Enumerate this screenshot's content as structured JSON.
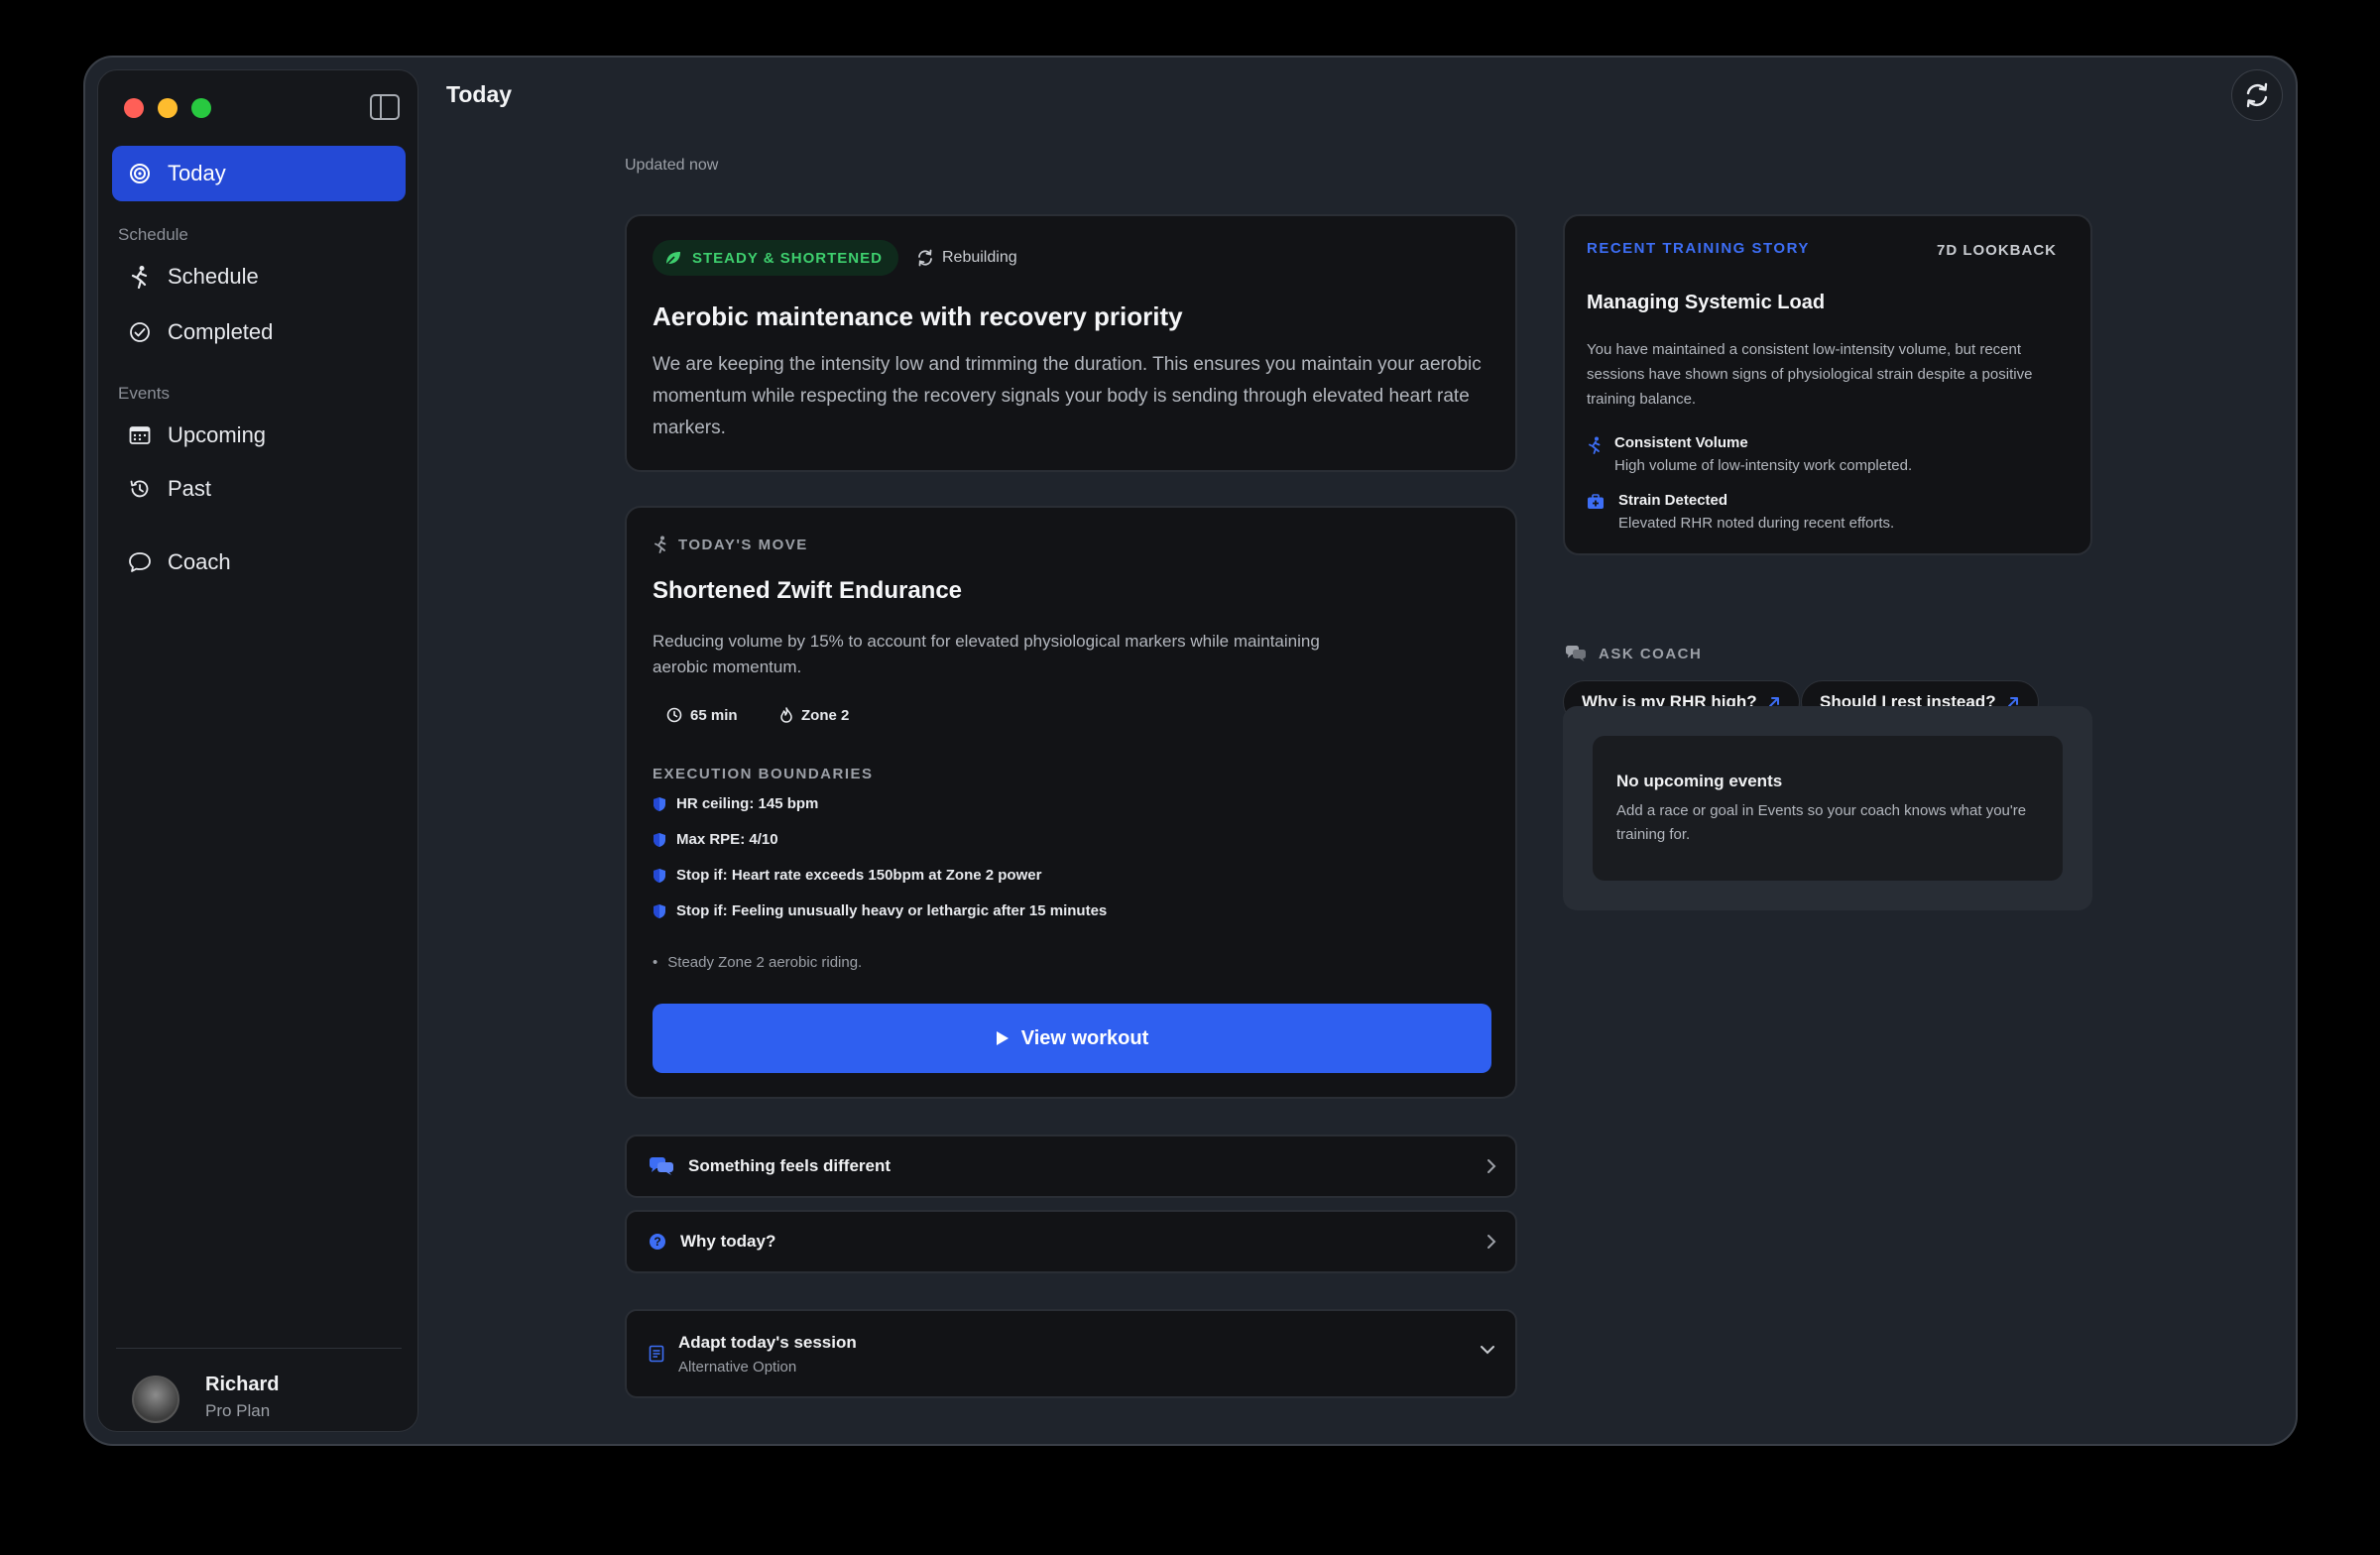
{
  "header": {
    "title": "Today",
    "updated": "Updated now"
  },
  "sidebar": {
    "today": "Today",
    "schedule_section": "Schedule",
    "schedule": "Schedule",
    "completed": "Completed",
    "events_section": "Events",
    "upcoming": "Upcoming",
    "past": "Past",
    "coach": "Coach",
    "user": {
      "name": "Richard",
      "plan": "Pro Plan"
    }
  },
  "hero": {
    "badge": "STEADY & SHORTENED",
    "status": "Rebuilding",
    "title": "Aerobic maintenance with recovery priority",
    "body": "We are keeping the intensity low and trimming the duration. This ensures you maintain your aerobic momentum while respecting the recovery signals your body is sending through elevated heart rate markers."
  },
  "move": {
    "label": "TODAY'S MOVE",
    "title": "Shortened Zwift Endurance",
    "description": "Reducing volume by 15% to account for elevated physiological markers while maintaining aerobic momentum.",
    "duration": "65 min",
    "zone": "Zone 2",
    "boundaries_label": "EXECUTION BOUNDARIES",
    "boundaries": [
      "HR ceiling: 145 bpm",
      "Max RPE: 4/10",
      "Stop if: Heart rate exceeds 150bpm at Zone 2 power",
      "Stop if: Feeling unusually heavy or lethargic after 15 minutes"
    ],
    "note": "Steady Zone 2 aerobic riding.",
    "button": "View workout"
  },
  "rows": {
    "different": "Something feels different",
    "why": "Why today?",
    "adapt_title": "Adapt today's session",
    "adapt_sub": "Alternative Option"
  },
  "story": {
    "label": "RECENT TRAINING STORY",
    "lookback": "7D LOOKBACK",
    "title": "Managing Systemic Load",
    "body": "You have maintained a consistent low-intensity volume, but recent sessions have shown signs of physiological strain despite a positive training balance.",
    "points": [
      {
        "title": "Consistent Volume",
        "sub": "High volume of low-intensity work completed."
      },
      {
        "title": "Strain Detected",
        "sub": "Elevated RHR noted during recent efforts."
      }
    ]
  },
  "ask": {
    "label": "ASK COACH",
    "q1": "Why is my RHR high?",
    "q2": "Should I rest instead?"
  },
  "events": {
    "title": "No upcoming events",
    "body": "Add a race or goal in Events so your coach knows what you're training for."
  },
  "colors": {
    "accent": "#2f5ff0",
    "active_nav": "#2449d6",
    "success": "#3ecf6e",
    "link": "#3d6ef5"
  }
}
